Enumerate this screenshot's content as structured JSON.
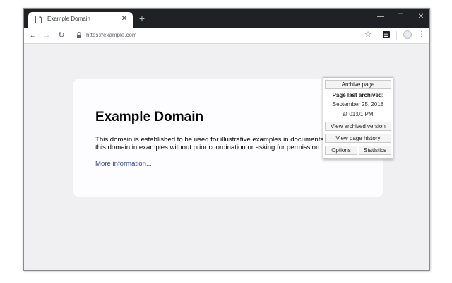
{
  "browser": {
    "tab": {
      "title": "Example Domain",
      "close_symbol": "✕"
    },
    "new_tab_symbol": "+",
    "window_controls": {
      "minimize": "—",
      "maximize": "☐",
      "close": "✕"
    },
    "nav": {
      "back": "←",
      "forward": "→",
      "reload": "↻"
    },
    "address": {
      "url": "https://example.com"
    },
    "bookmark_symbol": "☆",
    "menu_symbol": "⋮"
  },
  "page": {
    "heading": "Example Domain",
    "paragraph": "This domain is established to be used for illustrative examples in documents. You may use this domain in examples without prior coordination or asking for permission.",
    "link": "More information..."
  },
  "popup": {
    "archive_button": "Archive page",
    "last_archived_label": "Page last archived:",
    "last_archived_date": "September 25, 2018",
    "last_archived_time": "at 01:01 PM",
    "view_archived_button": "View archived version",
    "view_history_button": "View page history",
    "options_button": "Options",
    "statistics_button": "Statistics"
  },
  "colors": {
    "titlebar": "#202124",
    "page_background": "#f0f0f2",
    "card_background": "#fdfdff",
    "link": "#38488f"
  },
  "icons": [
    "page-favicon-icon",
    "lock-icon",
    "star-icon",
    "extension-icon",
    "profile-avatar-icon",
    "menu-dots-icon"
  ]
}
